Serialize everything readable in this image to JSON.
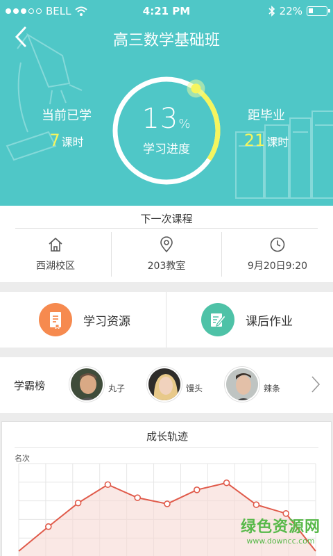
{
  "status_bar": {
    "carrier": "BELL",
    "time": "4:21 PM",
    "battery": "22%"
  },
  "header": {
    "title": "高三数学基础班",
    "studied": {
      "label": "当前已学",
      "count": "7",
      "unit": "课时"
    },
    "remaining": {
      "label": "距毕业",
      "count": "21",
      "unit": "课时"
    },
    "progress": {
      "value": "13",
      "percent_sign": "%",
      "label": "学习进度",
      "fraction": 0.13
    }
  },
  "next_class": {
    "caption": "下一次课程",
    "campus": "西湖校区",
    "room": "203教室",
    "time": "9月20日9:20"
  },
  "actions": {
    "resources": "学习资源",
    "homework": "课后作业"
  },
  "leaderboard": {
    "title": "学霸榜",
    "people": [
      {
        "name": "丸子"
      },
      {
        "name": "馒头"
      },
      {
        "name": "辣条"
      }
    ]
  },
  "growth": {
    "caption": "成长轨迹",
    "ylabel": "名次"
  },
  "chart_data": {
    "type": "area",
    "title": "成长轨迹",
    "ylabel": "名次",
    "x": [
      0,
      1,
      2,
      3,
      4,
      5,
      6,
      7,
      8,
      9,
      10
    ],
    "values": [
      0.0,
      0.28,
      0.55,
      0.76,
      0.61,
      0.54,
      0.7,
      0.78,
      0.53,
      0.43,
      0.0
    ],
    "grid": true
  },
  "watermark": {
    "big": "绿色资源网",
    "small": "www.downcc.com"
  },
  "colors": {
    "teal": "#4fc7c7",
    "yellow": "#f5f55e",
    "orange": "#f68a4f",
    "green": "#4ec2a7",
    "line": "#e05a4a"
  }
}
